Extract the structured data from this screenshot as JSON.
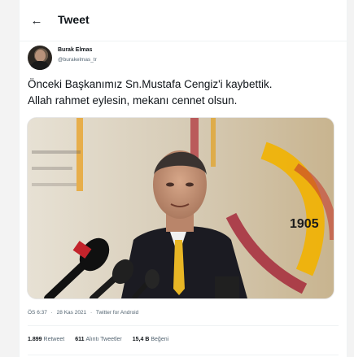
{
  "header": {
    "title": "Tweet",
    "back_glyph": "←"
  },
  "author": {
    "display_name": "Burak Elmas",
    "username": "@burakelmas_tr"
  },
  "tweet": {
    "text": "Önceki Başkanımız Sn.Mustafa Cengiz'i kaybettik.\nAllah rahmet eylesin, mekanı cennet olsun."
  },
  "media": {
    "banner_text": "1905"
  },
  "meta": {
    "time": "ÖS 6:37",
    "sep1": "·",
    "date": "28 Kas 2021",
    "sep2": "·",
    "source": "Twitter for Android"
  },
  "stats": {
    "retweets_count": "1.899",
    "retweets_label": "Retweet",
    "quotes_count": "611",
    "quotes_label": "Alıntı Tweetler",
    "likes_count": "15,4 B",
    "likes_label": "Beğeni"
  },
  "colors": {
    "brand": "#f5b400",
    "accent_red": "#a32035"
  }
}
